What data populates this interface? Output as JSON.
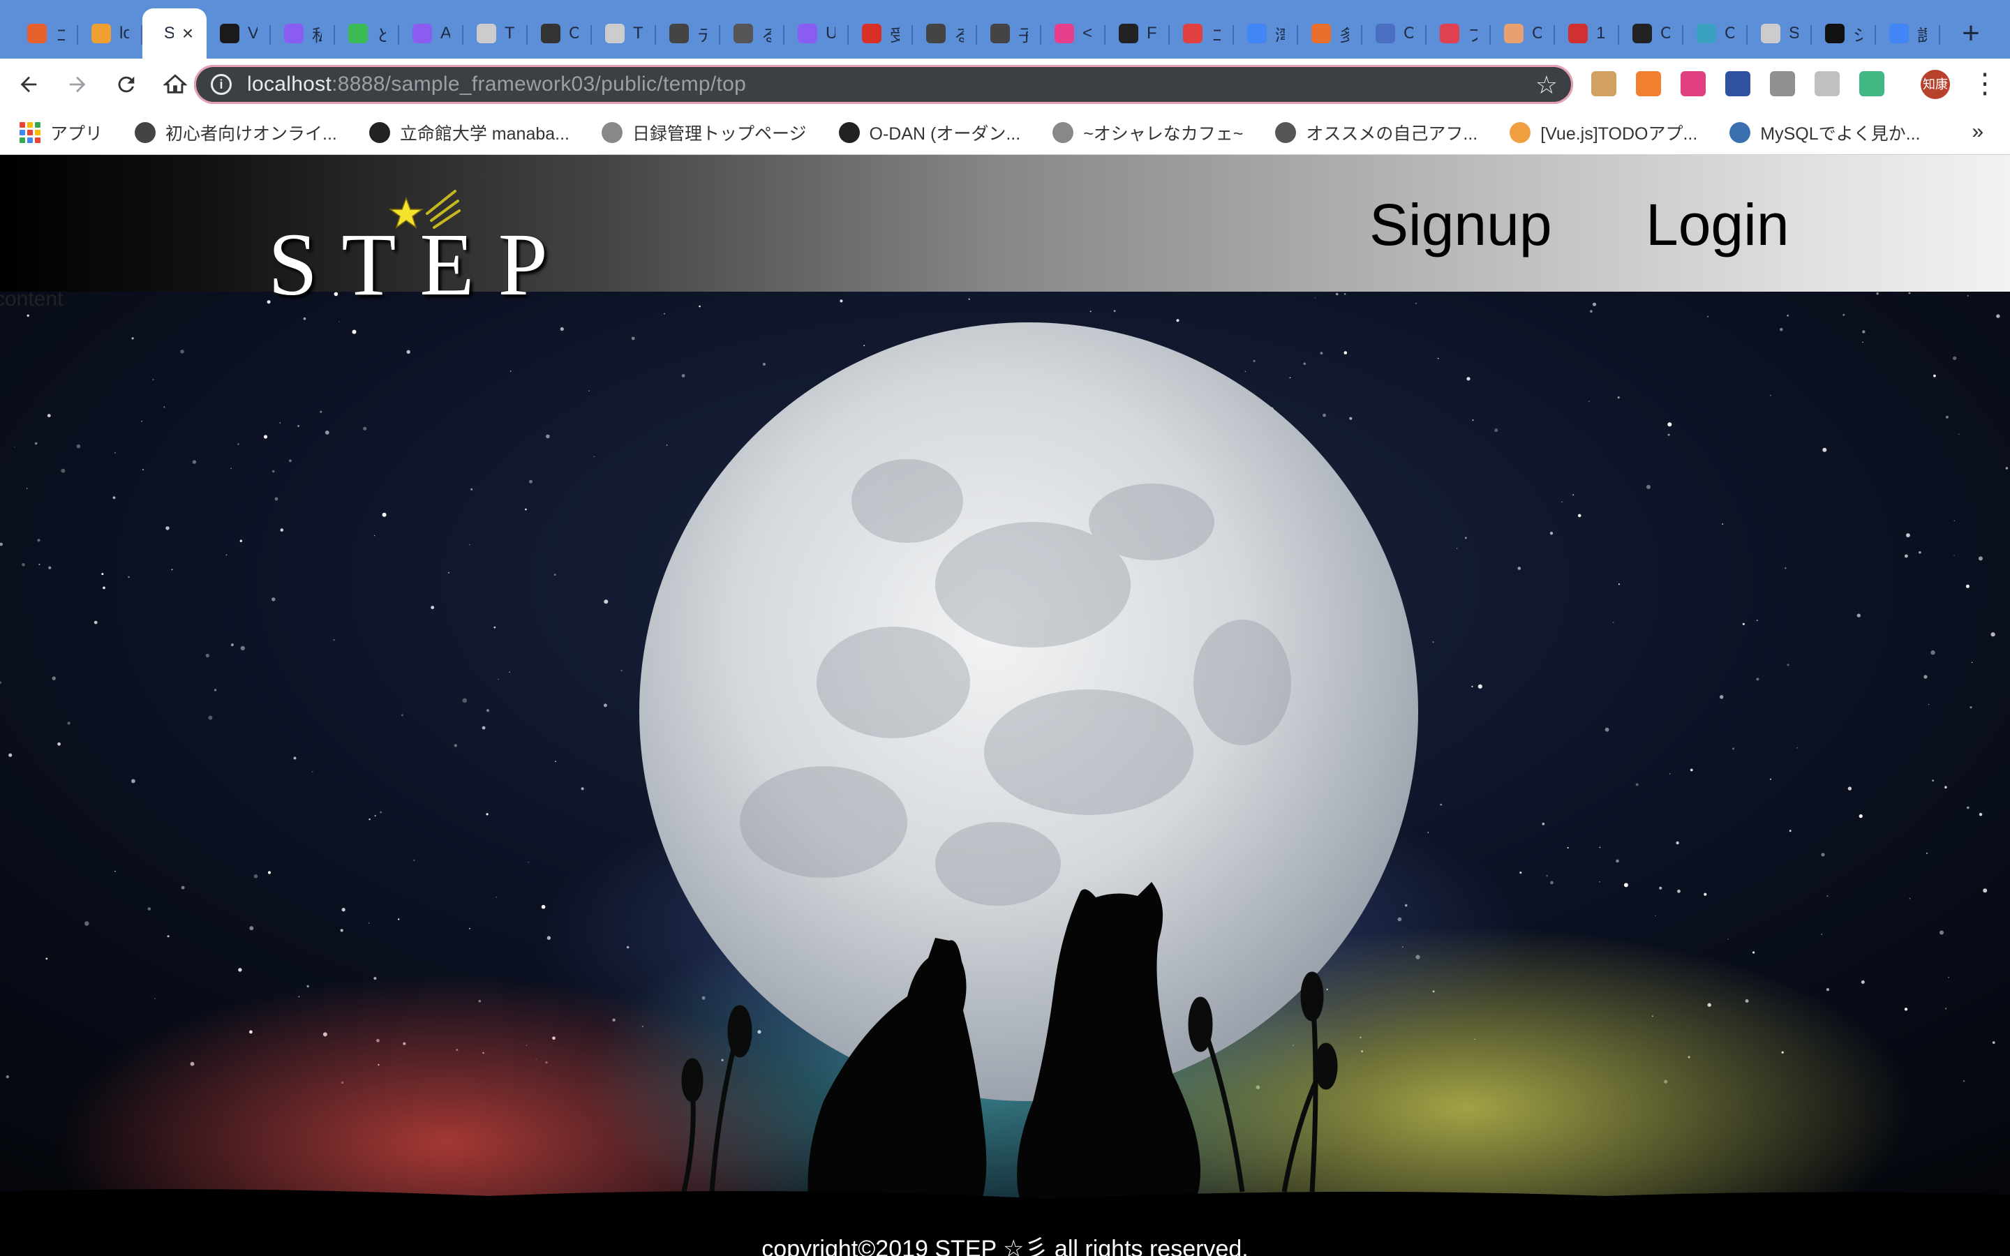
{
  "browser": {
    "tabs": [
      {
        "favicon": "undo-arrow-icon",
        "color": "#e8602c",
        "title": "コ",
        "active": false
      },
      {
        "favicon": "phpmyadmin-icon",
        "color": "#f0a030",
        "title": "lo",
        "active": false
      },
      {
        "favicon": "text",
        "color": "#ffffff",
        "title": "S",
        "active": true
      },
      {
        "favicon": "document-icon",
        "color": "#1a1a1a",
        "title": "V",
        "active": false
      },
      {
        "favicon": "drop-icon",
        "color": "#8a5cf0",
        "title": "私",
        "active": false
      },
      {
        "favicon": "q-icon",
        "color": "#3cba54",
        "title": "と",
        "active": false
      },
      {
        "favicon": "drop-icon",
        "color": "#8a5cf0",
        "title": "A",
        "active": false
      },
      {
        "favicon": "mushroom-icon",
        "color": "#cccccc",
        "title": "T",
        "active": false
      },
      {
        "favicon": "square-icon",
        "color": "#333333",
        "title": "C",
        "active": false
      },
      {
        "favicon": "mushroom-icon",
        "color": "#cccccc",
        "title": "T",
        "active": false
      },
      {
        "favicon": "w-icon",
        "color": "#444444",
        "title": "テ",
        "active": false
      },
      {
        "favicon": "globe-icon",
        "color": "#555555",
        "title": "る",
        "active": false
      },
      {
        "favicon": "drop-icon",
        "color": "#8a5cf0",
        "title": "U",
        "active": false
      },
      {
        "favicon": "gmail-icon",
        "color": "#d93025",
        "title": "受",
        "active": false
      },
      {
        "favicon": "w-icon",
        "color": "#444444",
        "title": "る",
        "active": false
      },
      {
        "favicon": "w-icon",
        "color": "#444444",
        "title": "子",
        "active": false
      },
      {
        "favicon": "heart-icon",
        "color": "#e83e8c",
        "title": "<",
        "active": false
      },
      {
        "favicon": "w-icon",
        "color": "#222222",
        "title": "F",
        "active": false
      },
      {
        "favicon": "g-red-icon",
        "color": "#e04040",
        "title": "コ",
        "active": false
      },
      {
        "favicon": "google-icon",
        "color": "#4285f4",
        "title": "湾",
        "active": false
      },
      {
        "favicon": "l-icon",
        "color": "#e8702c",
        "title": "多",
        "active": false
      },
      {
        "favicon": "link-icon",
        "color": "#4a6ec0",
        "title": "C",
        "active": false
      },
      {
        "favicon": "feather-icon",
        "color": "#e04050",
        "title": "フ",
        "active": false
      },
      {
        "favicon": "face-icon",
        "color": "#e8a070",
        "title": "C",
        "active": false
      },
      {
        "favicon": "calendar-icon",
        "color": "#d03030",
        "title": "1",
        "active": false
      },
      {
        "favicon": "terminal-icon",
        "color": "#222222",
        "title": "C",
        "active": false
      },
      {
        "favicon": "r-icon",
        "color": "#3aa0c0",
        "title": "C",
        "active": false
      },
      {
        "favicon": "mushroom-icon",
        "color": "#cccccc",
        "title": "S",
        "active": false
      },
      {
        "favicon": "b-icon",
        "color": "#111111",
        "title": "シ",
        "active": false
      },
      {
        "favicon": "google-icon",
        "color": "#4285f4",
        "title": "課",
        "active": false
      }
    ],
    "active_tab_close": "×",
    "new_tab_symbol": "+",
    "url_host": "localhost",
    "url_rest": ":8888/sample_framework03/public/temp/top",
    "info_symbol": "i",
    "bookmark_star": "☆",
    "profile_text": "知康",
    "menu_symbol": "⋮",
    "extensions": [
      {
        "name": "cookie-extension-icon",
        "color": "#d2a060"
      },
      {
        "name": "eraser-extension-icon",
        "color": "#f08030"
      },
      {
        "name": "color-wheel-extension-icon",
        "color": "#e04080"
      },
      {
        "name": "frame-extension-icon",
        "color": "#3050a0"
      },
      {
        "name": "ruler-extension-icon",
        "color": "#909090"
      },
      {
        "name": "cloud-extension-icon",
        "color": "#c0c0c0"
      },
      {
        "name": "vue-extension-icon",
        "color": "#41b883"
      }
    ],
    "bookmarks": [
      {
        "icon": "apps-grid-icon",
        "label": "アプリ",
        "color": "#4285f4"
      },
      {
        "icon": "w-icon",
        "label": "初心者向けオンライ...",
        "color": "#444444"
      },
      {
        "icon": "globe-icon",
        "label": "立命館大学 manaba...",
        "color": "#222222"
      },
      {
        "icon": "mushroom-icon",
        "label": "日録管理トップページ",
        "color": "#888888"
      },
      {
        "icon": "terminal-icon",
        "label": "O-DAN (オーダン...",
        "color": "#222222"
      },
      {
        "icon": "mushroom-icon",
        "label": "~オシャレなカフェ~",
        "color": "#888888"
      },
      {
        "icon": "photo-icon",
        "label": "オススメの自己アフ...",
        "color": "#555555"
      },
      {
        "icon": "sun-icon",
        "label": "[Vue.js]TODOアプ...",
        "color": "#f0a040"
      },
      {
        "icon": "dolphin-icon",
        "label": "MySQLでよく見か...",
        "color": "#3a70b0"
      }
    ],
    "bookmarks_more": "»"
  },
  "site": {
    "logo_text": "STEP",
    "nav": {
      "signup": "Signup",
      "login": "Login"
    },
    "content_label": "content",
    "footer": "copyright©2019 STEP ☆彡 all rights reserved.",
    "colors": {
      "header_dark": "#000000",
      "header_light": "#f2f2f2",
      "moon": "#d8dcde",
      "sky": "#0a0f1c"
    }
  }
}
